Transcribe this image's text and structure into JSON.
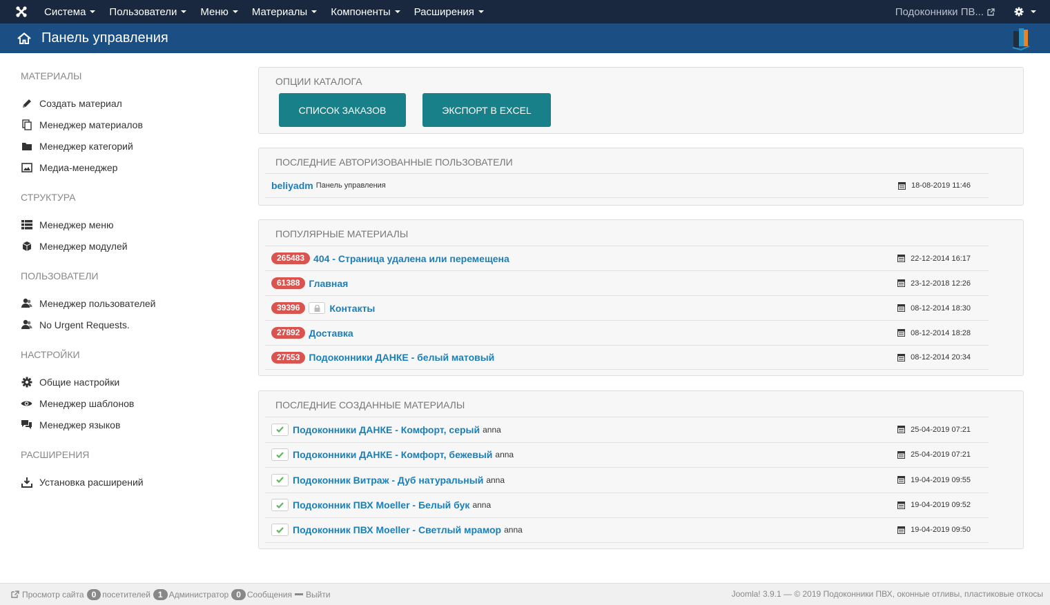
{
  "nav": {
    "menu": [
      "Система",
      "Пользователи",
      "Меню",
      "Материалы",
      "Компоненты",
      "Расширения"
    ],
    "site_name": "Подоконники ПВ..."
  },
  "header": {
    "title": "Панель управления"
  },
  "sidebar": {
    "groups": [
      {
        "heading": "МАТЕРИАЛЫ",
        "items": [
          {
            "label": "Создать материал",
            "icon": "pencil-icon"
          },
          {
            "label": "Менеджер материалов",
            "icon": "copy-icon"
          },
          {
            "label": "Менеджер категорий",
            "icon": "folder-icon"
          },
          {
            "label": "Медиа-менеджер",
            "icon": "image-icon"
          }
        ]
      },
      {
        "heading": "СТРУКТУРА",
        "items": [
          {
            "label": "Менеджер меню",
            "icon": "list-icon"
          },
          {
            "label": "Менеджер модулей",
            "icon": "cube-icon"
          }
        ]
      },
      {
        "heading": "ПОЛЬЗОВАТЕЛИ",
        "items": [
          {
            "label": "Менеджер пользователей",
            "icon": "users-icon"
          },
          {
            "label": "No Urgent Requests.",
            "icon": "users-icon"
          }
        ]
      },
      {
        "heading": "НАСТРОЙКИ",
        "items": [
          {
            "label": "Общие настройки",
            "icon": "gear-icon"
          },
          {
            "label": "Менеджер шаблонов",
            "icon": "eye-icon"
          },
          {
            "label": "Менеджер языков",
            "icon": "comments-icon"
          }
        ]
      },
      {
        "heading": "РАСШИРЕНИЯ",
        "items": [
          {
            "label": "Установка расширений",
            "icon": "download-icon"
          }
        ]
      }
    ]
  },
  "catalog": {
    "title": "ОПЦИИ КАТАЛОГА",
    "orders_button": "СПИСОК ЗАКАЗОВ",
    "export_button": "ЭКСПОРТ В EXCEL"
  },
  "logged": {
    "title": "ПОСЛЕДНИЕ АВТОРИЗОВАННЫЕ ПОЛЬЗОВАТЕЛИ",
    "rows": [
      {
        "user": "beliyadm",
        "where": "Панель управления",
        "date": "18-08-2019 11:46"
      }
    ]
  },
  "popular": {
    "title": "ПОПУЛЯРНЫЕ МАТЕРИАЛЫ",
    "rows": [
      {
        "hits": "265483",
        "title": "404 - Страница удалена или перемещена",
        "date": "22-12-2014 16:17",
        "locked": false
      },
      {
        "hits": "61388",
        "title": "Главная",
        "date": "23-12-2018 12:26",
        "locked": false
      },
      {
        "hits": "39396",
        "title": "Контакты",
        "date": "08-12-2014 18:30",
        "locked": true
      },
      {
        "hits": "27892",
        "title": "Доставка",
        "date": "08-12-2014 18:28",
        "locked": false
      },
      {
        "hits": "27553",
        "title": "Подоконники ДАНКЕ - белый матовый",
        "date": "08-12-2014 20:34",
        "locked": false
      }
    ]
  },
  "latest": {
    "title": "ПОСЛЕДНИЕ СОЗДАННЫЕ МАТЕРИАЛЫ",
    "rows": [
      {
        "title": "Подоконники ДАНКЕ - Комфорт, серый",
        "author": "anna",
        "date": "25-04-2019 07:21"
      },
      {
        "title": "Подоконники ДАНКЕ - Комфорт, бежевый",
        "author": "anna",
        "date": "25-04-2019 07:21"
      },
      {
        "title": "Подоконник Витраж - Дуб натуральный",
        "author": "anna",
        "date": "19-04-2019 09:55"
      },
      {
        "title": "Подоконник ПВХ Moeller - Белый бук",
        "author": "anna",
        "date": "19-04-2019 09:52"
      },
      {
        "title": "Подоконник ПВХ Moeller - Светлый мрамор",
        "author": "anna",
        "date": "19-04-2019 09:50"
      }
    ]
  },
  "footer": {
    "view_site": "Просмотр сайта",
    "visitors_count": "0",
    "visitors_label": "посетителей",
    "admins_count": "1",
    "admins_label": "Администратор",
    "messages_count": "0",
    "messages_label": "Сообщения",
    "logout": "Выйти",
    "copyright": "Joomla! 3.9.1 — © 2019 Подоконники ПВХ, оконные отливы, пластиковые откосы"
  },
  "colors": {
    "navbar": "#19283f",
    "header": "#1b4f83",
    "button": "#178088",
    "link": "#1a7fb8",
    "badge": "#d9534f"
  }
}
